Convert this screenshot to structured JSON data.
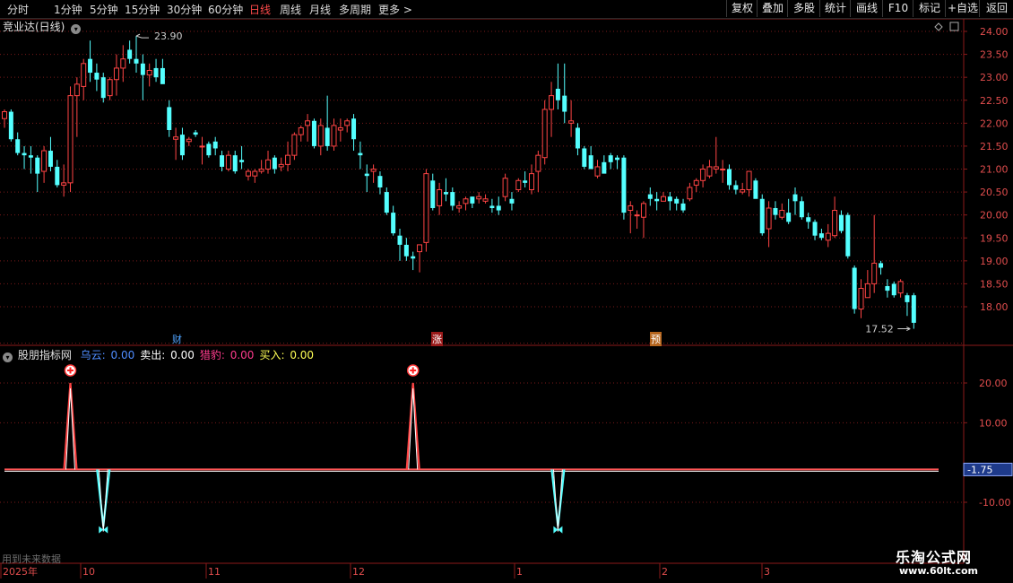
{
  "toolbar": {
    "periods": [
      "分时",
      "1分钟",
      "5分钟",
      "15分钟",
      "30分钟",
      "60分钟",
      "日线",
      "周线",
      "月线",
      "多周期",
      "更多 >"
    ],
    "active_period": "日线",
    "right_buttons": [
      "复权",
      "叠加",
      "多股",
      "统计",
      "画线",
      "F10",
      "标记",
      "+自选",
      "返回"
    ]
  },
  "stock": {
    "title": "竞业达(日线)"
  },
  "main_chart": {
    "price_axis": [
      "24.00",
      "23.50",
      "23.00",
      "22.50",
      "22.00",
      "21.50",
      "21.00",
      "20.50",
      "20.00",
      "19.50",
      "19.00",
      "18.50",
      "18.00"
    ],
    "high_marker": "23.90",
    "low_marker": "17.52",
    "events": [
      {
        "label": "财",
        "color": "#4fa3ff",
        "bg": "transparent"
      },
      {
        "label": "涨",
        "color": "#ffffff",
        "bg": "#9a1a1a"
      },
      {
        "label": "预",
        "color": "#ffffff",
        "bg": "#b5651d"
      }
    ]
  },
  "indicator": {
    "name": "股朋指标网",
    "params": [
      {
        "label": "乌云:",
        "value": "0.00",
        "color": "#4f8dff"
      },
      {
        "label": "卖出:",
        "value": "0.00",
        "color": "#ffffff"
      },
      {
        "label": "猎豹:",
        "value": "0.00",
        "color": "#ff3b8d"
      },
      {
        "label": "买入:",
        "value": "0.00",
        "color": "#ffff55"
      }
    ],
    "axis": [
      "20.00",
      "10.00",
      "-10.00"
    ],
    "current_value": "-1.75",
    "note": "用到未来数据"
  },
  "time_axis": [
    "2025年",
    "10",
    "11",
    "12",
    "1",
    "2",
    "3"
  ],
  "watermark": {
    "line1": "乐淘公式网",
    "line2": "www.60lt.com"
  },
  "colors": {
    "up": "#ff4444",
    "down": "#54ffff",
    "grid": "#7a1a1a",
    "bg": "#000000"
  },
  "chart_data": {
    "type": "candlestick",
    "ylim": [
      17.5,
      24.1
    ],
    "candles": [
      [
        22.1,
        22.3,
        21.9,
        22.25
      ],
      [
        22.25,
        22.3,
        21.6,
        21.65
      ],
      [
        21.65,
        21.8,
        21.3,
        21.35
      ],
      [
        21.35,
        21.5,
        21.0,
        21.3
      ],
      [
        21.3,
        21.5,
        20.9,
        21.25
      ],
      [
        21.25,
        21.3,
        20.5,
        20.9
      ],
      [
        20.95,
        21.5,
        20.7,
        21.4
      ],
      [
        21.4,
        21.7,
        20.95,
        21.05
      ],
      [
        21.05,
        21.2,
        20.6,
        20.65
      ],
      [
        20.65,
        21.1,
        20.4,
        20.7
      ],
      [
        20.7,
        22.8,
        20.5,
        22.6
      ],
      [
        22.6,
        23.0,
        21.7,
        22.85
      ],
      [
        22.8,
        23.4,
        22.5,
        23.3
      ],
      [
        23.4,
        23.8,
        22.9,
        23.1
      ],
      [
        23.1,
        23.3,
        22.7,
        22.95
      ],
      [
        23.0,
        23.1,
        22.45,
        22.55
      ],
      [
        22.6,
        23.0,
        22.5,
        22.95
      ],
      [
        22.95,
        23.5,
        22.6,
        23.2
      ],
      [
        23.2,
        23.7,
        22.9,
        23.4
      ],
      [
        23.6,
        23.8,
        23.3,
        23.4
      ],
      [
        23.4,
        23.9,
        23.1,
        23.3
      ],
      [
        23.3,
        23.5,
        22.5,
        23.05
      ],
      [
        23.05,
        23.3,
        22.8,
        23.15
      ],
      [
        23.2,
        23.4,
        22.9,
        23.0
      ],
      [
        23.2,
        23.4,
        23.0,
        22.85
      ],
      [
        22.35,
        22.5,
        21.7,
        21.85
      ],
      [
        21.65,
        21.9,
        21.2,
        21.7
      ],
      [
        21.75,
        21.9,
        21.2,
        21.3
      ],
      [
        21.6,
        21.7,
        21.5,
        21.65
      ],
      [
        21.8,
        21.85,
        21.7,
        21.75
      ],
      [
        21.5,
        21.7,
        21.1,
        21.5
      ],
      [
        21.55,
        21.6,
        21.25,
        21.3
      ],
      [
        21.6,
        21.7,
        21.3,
        21.45
      ],
      [
        21.3,
        21.4,
        20.95,
        21.05
      ],
      [
        21.0,
        21.4,
        20.95,
        21.3
      ],
      [
        21.3,
        21.4,
        20.9,
        20.95
      ],
      [
        21.2,
        21.5,
        21.0,
        21.15
      ],
      [
        20.85,
        21.0,
        20.75,
        20.95
      ],
      [
        20.85,
        21.0,
        20.7,
        20.95
      ],
      [
        20.95,
        21.2,
        20.9,
        21.0
      ],
      [
        21.0,
        21.4,
        20.9,
        21.2
      ],
      [
        21.25,
        21.3,
        20.9,
        21.0
      ],
      [
        21.05,
        21.25,
        20.95,
        21.1
      ],
      [
        21.1,
        21.6,
        20.95,
        21.3
      ],
      [
        21.3,
        21.8,
        21.2,
        21.75
      ],
      [
        21.75,
        21.95,
        21.6,
        21.9
      ],
      [
        21.95,
        22.2,
        21.6,
        22.05
      ],
      [
        22.05,
        22.1,
        21.45,
        21.5
      ],
      [
        21.5,
        22.1,
        21.3,
        21.95
      ],
      [
        21.9,
        22.6,
        21.4,
        21.5
      ],
      [
        21.5,
        22.1,
        21.4,
        21.95
      ],
      [
        21.85,
        22.1,
        21.6,
        21.9
      ],
      [
        21.95,
        22.1,
        21.8,
        22.05
      ],
      [
        22.1,
        22.2,
        21.4,
        21.65
      ],
      [
        21.35,
        21.6,
        21.0,
        21.3
      ],
      [
        20.9,
        21.1,
        20.5,
        20.85
      ],
      [
        20.95,
        21.1,
        20.7,
        21.0
      ],
      [
        20.85,
        20.95,
        20.45,
        20.6
      ],
      [
        20.5,
        20.6,
        20.0,
        20.05
      ],
      [
        20.05,
        20.2,
        19.55,
        19.6
      ],
      [
        19.55,
        19.7,
        19.0,
        19.35
      ],
      [
        19.35,
        19.5,
        19.0,
        19.1
      ],
      [
        19.1,
        19.2,
        18.8,
        19.05
      ],
      [
        19.2,
        19.35,
        18.75,
        19.35
      ],
      [
        19.4,
        21.0,
        19.2,
        20.9
      ],
      [
        20.75,
        20.9,
        20.1,
        20.15
      ],
      [
        20.2,
        20.7,
        20.0,
        20.55
      ],
      [
        20.5,
        20.8,
        20.3,
        20.45
      ],
      [
        20.5,
        20.6,
        20.1,
        20.2
      ],
      [
        20.15,
        20.3,
        20.05,
        20.2
      ],
      [
        20.25,
        20.4,
        20.1,
        20.35
      ],
      [
        20.4,
        20.4,
        20.15,
        20.25
      ],
      [
        20.35,
        20.5,
        20.25,
        20.4
      ],
      [
        20.3,
        20.45,
        20.25,
        20.35
      ],
      [
        20.2,
        20.35,
        20.05,
        20.15
      ],
      [
        20.2,
        20.4,
        20.0,
        20.1
      ],
      [
        20.4,
        20.9,
        20.3,
        20.8
      ],
      [
        20.35,
        20.5,
        20.1,
        20.25
      ],
      [
        20.55,
        20.8,
        20.5,
        20.75
      ],
      [
        20.75,
        20.95,
        20.6,
        20.7
      ],
      [
        20.55,
        21.1,
        20.45,
        20.9
      ],
      [
        20.95,
        21.4,
        20.5,
        21.3
      ],
      [
        21.25,
        22.5,
        21.1,
        22.3
      ],
      [
        22.3,
        22.9,
        21.7,
        22.6
      ],
      [
        22.75,
        23.3,
        22.3,
        22.5
      ],
      [
        22.6,
        23.3,
        22.0,
        22.25
      ],
      [
        22.0,
        22.5,
        21.7,
        22.05
      ],
      [
        21.9,
        22.0,
        21.3,
        21.45
      ],
      [
        21.45,
        21.5,
        21.0,
        21.05
      ],
      [
        21.3,
        21.5,
        21.0,
        21.0
      ],
      [
        20.85,
        21.2,
        20.8,
        21.05
      ],
      [
        21.15,
        21.3,
        20.95,
        20.9
      ],
      [
        21.3,
        21.35,
        21.0,
        21.15
      ],
      [
        21.25,
        21.3,
        21.0,
        21.2
      ],
      [
        21.25,
        21.3,
        19.9,
        20.05
      ],
      [
        20.1,
        20.3,
        19.6,
        20.2
      ],
      [
        20.0,
        20.1,
        19.7,
        20.0
      ],
      [
        19.95,
        20.3,
        19.5,
        20.25
      ],
      [
        20.45,
        20.6,
        20.2,
        20.35
      ],
      [
        20.35,
        20.5,
        20.1,
        20.3
      ],
      [
        20.3,
        20.5,
        20.3,
        20.4
      ],
      [
        20.4,
        20.5,
        20.1,
        20.3
      ],
      [
        20.35,
        20.4,
        20.1,
        20.25
      ],
      [
        20.25,
        20.35,
        20.05,
        20.1
      ],
      [
        20.35,
        20.7,
        20.3,
        20.6
      ],
      [
        20.65,
        20.8,
        20.5,
        20.75
      ],
      [
        20.75,
        21.1,
        20.6,
        21.0
      ],
      [
        20.85,
        21.2,
        20.8,
        21.05
      ],
      [
        21.0,
        21.7,
        20.9,
        21.05
      ],
      [
        21.0,
        21.2,
        20.7,
        21.0
      ],
      [
        21.0,
        21.1,
        20.55,
        20.65
      ],
      [
        20.65,
        20.75,
        20.45,
        20.55
      ],
      [
        20.5,
        20.7,
        20.45,
        20.55
      ],
      [
        20.55,
        20.95,
        20.4,
        20.95
      ],
      [
        20.75,
        20.8,
        20.4,
        20.35
      ],
      [
        20.35,
        20.45,
        19.55,
        19.6
      ],
      [
        19.7,
        20.3,
        19.3,
        20.15
      ],
      [
        20.15,
        20.3,
        19.9,
        20.0
      ],
      [
        19.95,
        20.25,
        19.9,
        20.1
      ],
      [
        20.05,
        20.35,
        19.8,
        19.85
      ],
      [
        20.45,
        20.6,
        20.0,
        20.3
      ],
      [
        20.3,
        20.4,
        19.9,
        19.95
      ],
      [
        19.95,
        20.05,
        19.7,
        19.85
      ],
      [
        19.85,
        19.9,
        19.45,
        19.55
      ],
      [
        19.6,
        19.7,
        19.45,
        19.5
      ],
      [
        19.45,
        19.8,
        19.3,
        19.6
      ],
      [
        19.55,
        20.4,
        19.5,
        20.1
      ],
      [
        20.0,
        20.1,
        19.6,
        19.65
      ],
      [
        20.0,
        20.05,
        19.05,
        19.1
      ],
      [
        18.85,
        18.9,
        17.85,
        17.95
      ],
      [
        17.95,
        18.6,
        17.75,
        18.4
      ],
      [
        18.2,
        18.8,
        18.2,
        18.5
      ],
      [
        18.5,
        20.0,
        18.3,
        18.95
      ],
      [
        18.95,
        19.0,
        18.7,
        18.85
      ],
      [
        18.45,
        18.6,
        18.2,
        18.35
      ],
      [
        18.5,
        18.55,
        18.2,
        18.25
      ],
      [
        18.3,
        18.6,
        18.2,
        18.55
      ],
      [
        18.25,
        18.3,
        17.8,
        18.1
      ],
      [
        18.25,
        18.3,
        17.52,
        17.65
      ]
    ],
    "indicator_lines": [
      {
        "name": "卖出",
        "type": "spike",
        "color": "#ff4444",
        "peak_value": 20,
        "indices": [
          10,
          62
        ]
      },
      {
        "name": "买入",
        "type": "spike",
        "color": "#54ffff",
        "peak_value": -16,
        "indices": [
          15,
          84
        ]
      }
    ],
    "baseline_value": -1.75
  }
}
